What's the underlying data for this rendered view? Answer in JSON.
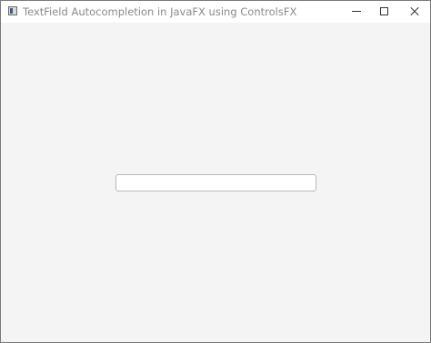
{
  "window": {
    "title": "TextField Autocompletion in JavaFX using ControlsFX"
  },
  "text_field": {
    "value": "",
    "placeholder": ""
  }
}
